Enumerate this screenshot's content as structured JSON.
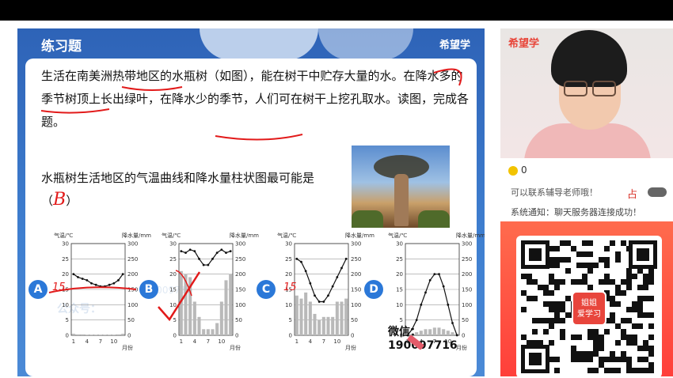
{
  "slide": {
    "title": "练习题",
    "brand": "希望学",
    "paragraph": "生活在南美洲热带地区的水瓶树（如图），能在树干中贮存大量的水。在降水多的季节树顶上长出绿叶，在降水少的季节，人们可在树干上挖孔取水。读图，完成各题。",
    "question": "水瓶树生活地区的气温曲线和降水量柱状图最可能是（",
    "question_end": "）",
    "handwritten_answer": "B",
    "wechat": "微信：190097716",
    "watermark": "公众号：",
    "watermark2": "19009716"
  },
  "charts": {
    "temp_label": "气温/℃",
    "precip_label": "降水量/mm",
    "month_label": "月份",
    "temp_ticks": [
      "30",
      "25",
      "20",
      "15",
      "10",
      "5",
      "0"
    ],
    "precip_ticks": [
      "300",
      "250",
      "200",
      "150",
      "100",
      "50",
      "0"
    ],
    "x_ticks": [
      "1",
      "4",
      "7",
      "10"
    ],
    "options": [
      "A",
      "B",
      "C",
      "D"
    ],
    "annotation_15": "15"
  },
  "chart_data": [
    {
      "type": "line+bar",
      "name": "A",
      "x": [
        1,
        2,
        3,
        4,
        5,
        6,
        7,
        8,
        9,
        10,
        11,
        12
      ],
      "temperature": [
        20,
        19,
        18.5,
        18,
        17,
        16.5,
        16,
        16,
        16.5,
        17,
        18,
        20
      ],
      "precipitation": [
        5,
        3,
        3,
        2,
        2,
        2,
        2,
        2,
        2,
        2,
        3,
        5
      ],
      "ylim_temp": [
        0,
        30
      ],
      "ylim_precip": [
        0,
        300
      ]
    },
    {
      "type": "line+bar",
      "name": "B",
      "x": [
        1,
        2,
        3,
        4,
        5,
        6,
        7,
        8,
        9,
        10,
        11,
        12
      ],
      "temperature": [
        27.5,
        27,
        28,
        27.5,
        25,
        23,
        23,
        25,
        27,
        28,
        27,
        27.5
      ],
      "precipitation": [
        210,
        200,
        190,
        110,
        60,
        20,
        20,
        20,
        40,
        110,
        180,
        200
      ],
      "ylim_temp": [
        0,
        30
      ],
      "ylim_precip": [
        0,
        300
      ]
    },
    {
      "type": "line+bar",
      "name": "C",
      "x": [
        1,
        2,
        3,
        4,
        5,
        6,
        7,
        8,
        9,
        10,
        11,
        12
      ],
      "temperature": [
        25,
        24,
        21,
        17,
        13,
        11,
        11,
        13,
        16,
        19,
        22,
        25
      ],
      "precipitation": [
        130,
        120,
        140,
        110,
        70,
        50,
        60,
        60,
        60,
        110,
        110,
        120
      ],
      "ylim_temp": [
        0,
        30
      ],
      "ylim_precip": [
        0,
        300
      ]
    },
    {
      "type": "line+bar",
      "name": "D",
      "x": [
        1,
        2,
        3,
        4,
        5,
        6,
        7,
        8,
        9,
        10,
        11,
        12
      ],
      "temperature": [
        0,
        2,
        5,
        10,
        14,
        18,
        20,
        20,
        16,
        10,
        4,
        0
      ],
      "precipitation": [
        5,
        5,
        10,
        15,
        20,
        20,
        25,
        25,
        20,
        15,
        10,
        5
      ],
      "ylim_temp": [
        0,
        30
      ],
      "ylim_precip": [
        0,
        300
      ]
    }
  ],
  "live_panel": {
    "cam_logo": "希望学",
    "like_count": "0",
    "cut_text": "可以联系辅导老师哦！",
    "gift_icon": "gift-icon",
    "system_notice": "系统通知：聊天服务器连接成功！",
    "qr_badge": "姐姐\n爱学习"
  },
  "colors": {
    "slide_blue": "#2e63b7",
    "badge_blue": "#2b78d8",
    "annotation_red": "#e21a1a",
    "qr_red": "#ff4a3f"
  }
}
